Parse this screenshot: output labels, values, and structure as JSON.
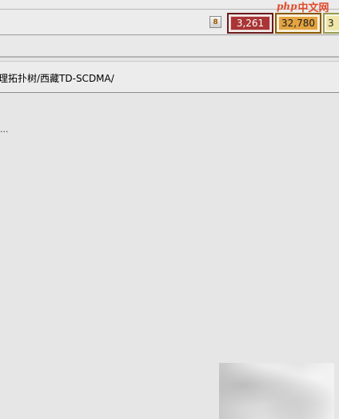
{
  "toolbar": {
    "icon_glyph": "8",
    "counters": [
      {
        "value": "3,261",
        "color": "#a93535"
      },
      {
        "value": "32,780",
        "color": "#e3a341"
      },
      {
        "value": "3",
        "color": "#efe6a8"
      }
    ]
  },
  "watermark": {
    "latin": "php",
    "cjk": "中文网"
  },
  "path_bar": {
    "text": "理拓扑树/西藏TD-SCDMA/"
  },
  "content": {
    "ellipsis": "..."
  }
}
